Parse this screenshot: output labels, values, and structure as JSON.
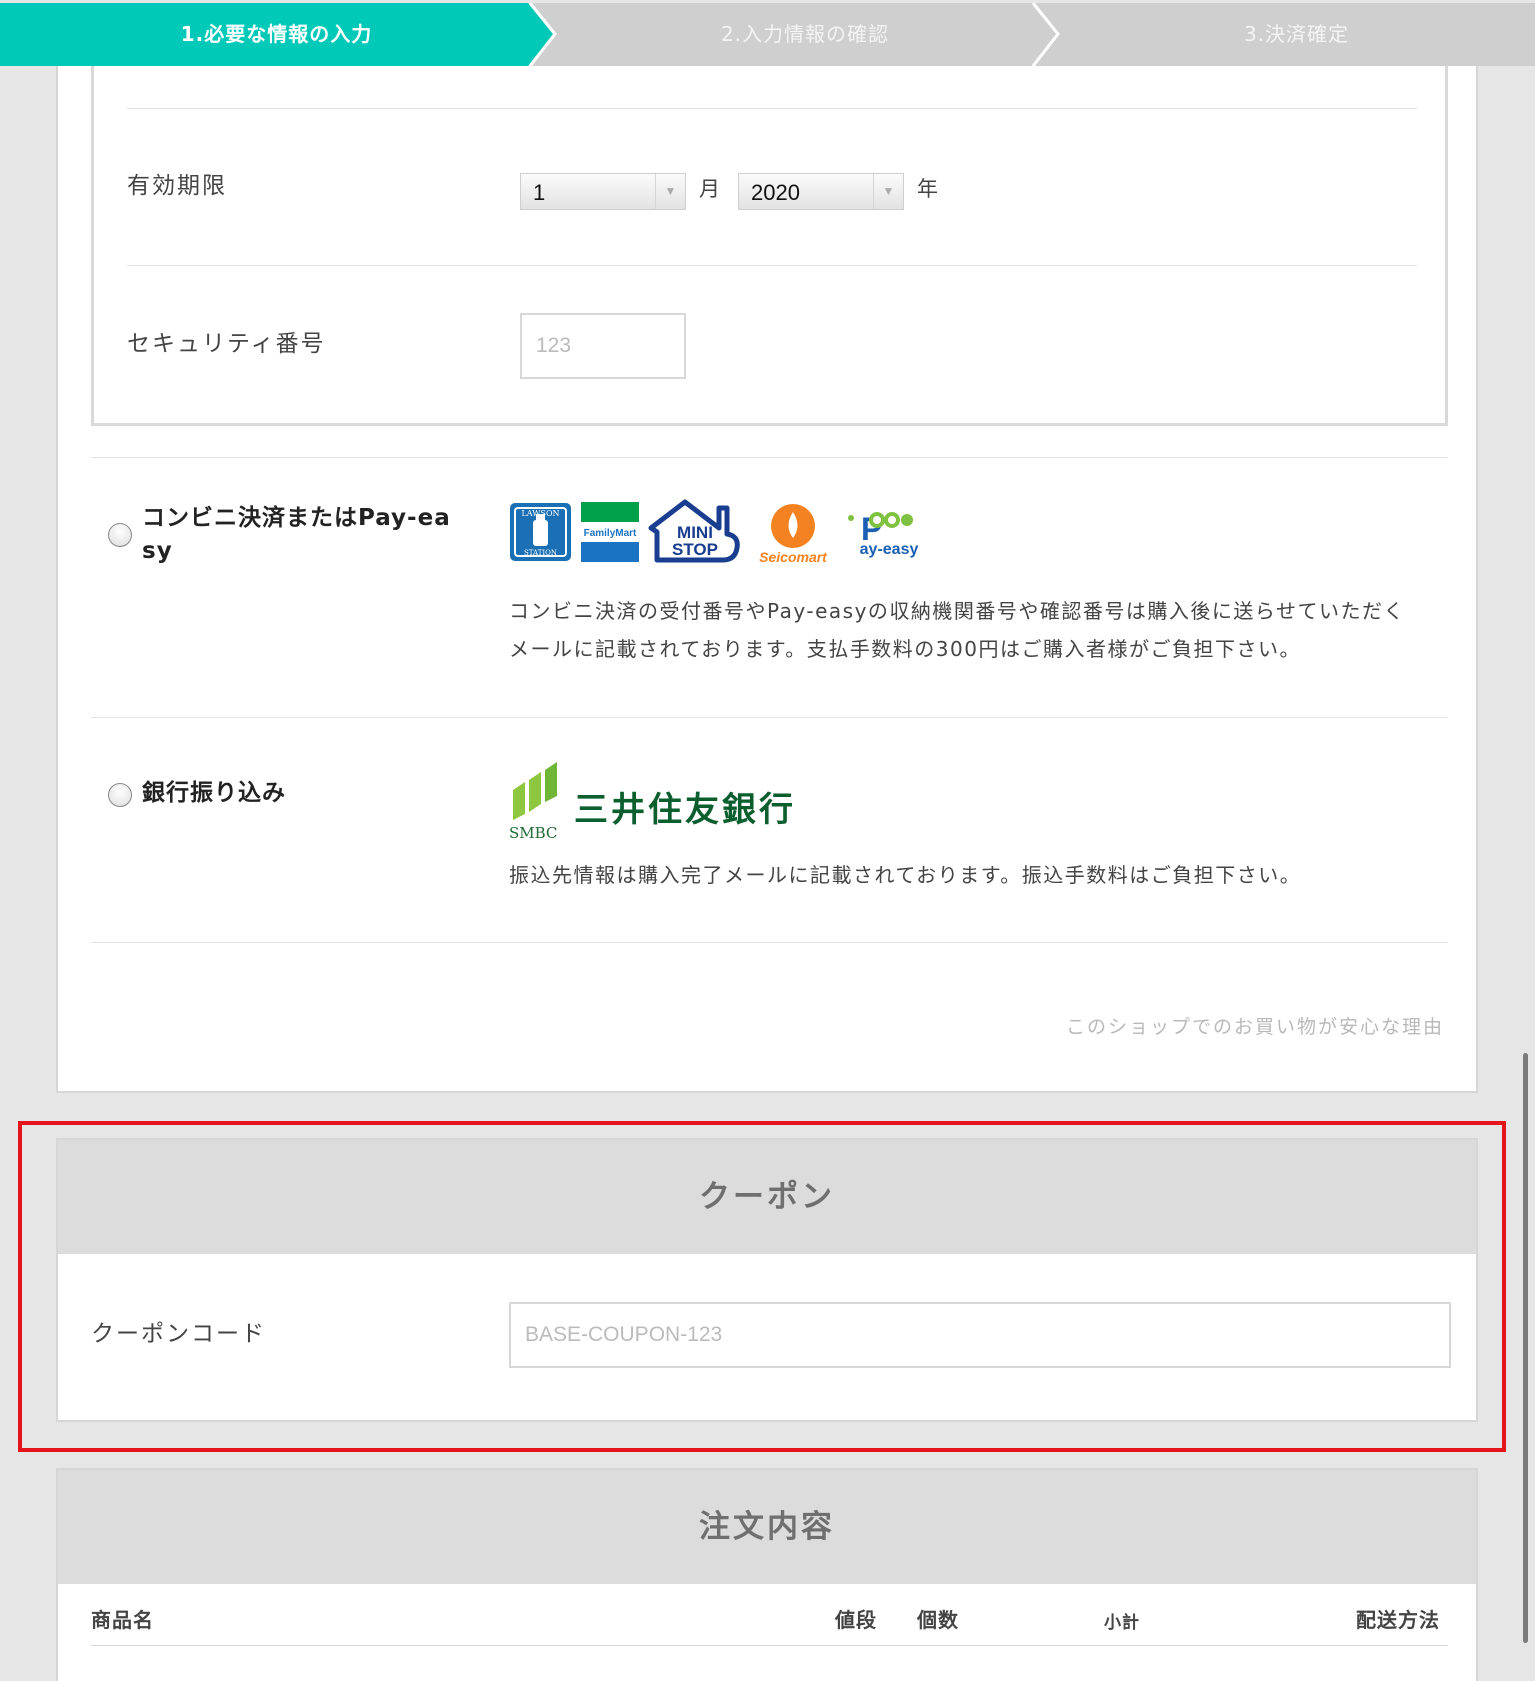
{
  "steps": [
    {
      "label": "1.必要な情報の入力",
      "active": true
    },
    {
      "label": "2.入力情報の確認",
      "active": false
    },
    {
      "label": "3.決済確定",
      "active": false
    }
  ],
  "colors": {
    "accent": "#00c9b7",
    "inactive_step": "#cfcfcf",
    "highlight": "#e3141c"
  },
  "card_form": {
    "expiry_label": "有効期限",
    "month_value": "1",
    "month_unit": "月",
    "year_value": "2020",
    "year_unit": "年",
    "security_label": "セキュリティ番号",
    "security_placeholder": "123"
  },
  "convenience": {
    "title": "コンビニ決済またはPay-easy",
    "title_line1": "コンビニ決済またはPay-ea",
    "title_line2": "sy",
    "logos": [
      "LAWSON STATION",
      "FamilyMart",
      "MINI STOP",
      "Seicomart",
      "Pay-easy"
    ],
    "desc_line1": "コンビニ決済の受付番号やPay-easyの収納機関番号や確認番号は購入後に送らせていただく",
    "desc_line2": "メールに記載されております。支払手数料の300円はご購入者様がご負担下さい。"
  },
  "bank": {
    "title": "銀行振り込み",
    "logo_mark": "SMBC",
    "logo_name": "三井住友銀行",
    "desc": "振込先情報は購入完了メールに記載されております。振込手数料はご負担下さい。"
  },
  "safe_link": "このショップでのお買い物が安心な理由",
  "coupon": {
    "heading": "クーポン",
    "label": "クーポンコード",
    "placeholder": "BASE-COUPON-123"
  },
  "order": {
    "heading": "注文内容",
    "columns": {
      "name": "商品名",
      "price": "値段",
      "qty": "個数",
      "subtotal": "小計",
      "shipping": "配送方法"
    }
  }
}
